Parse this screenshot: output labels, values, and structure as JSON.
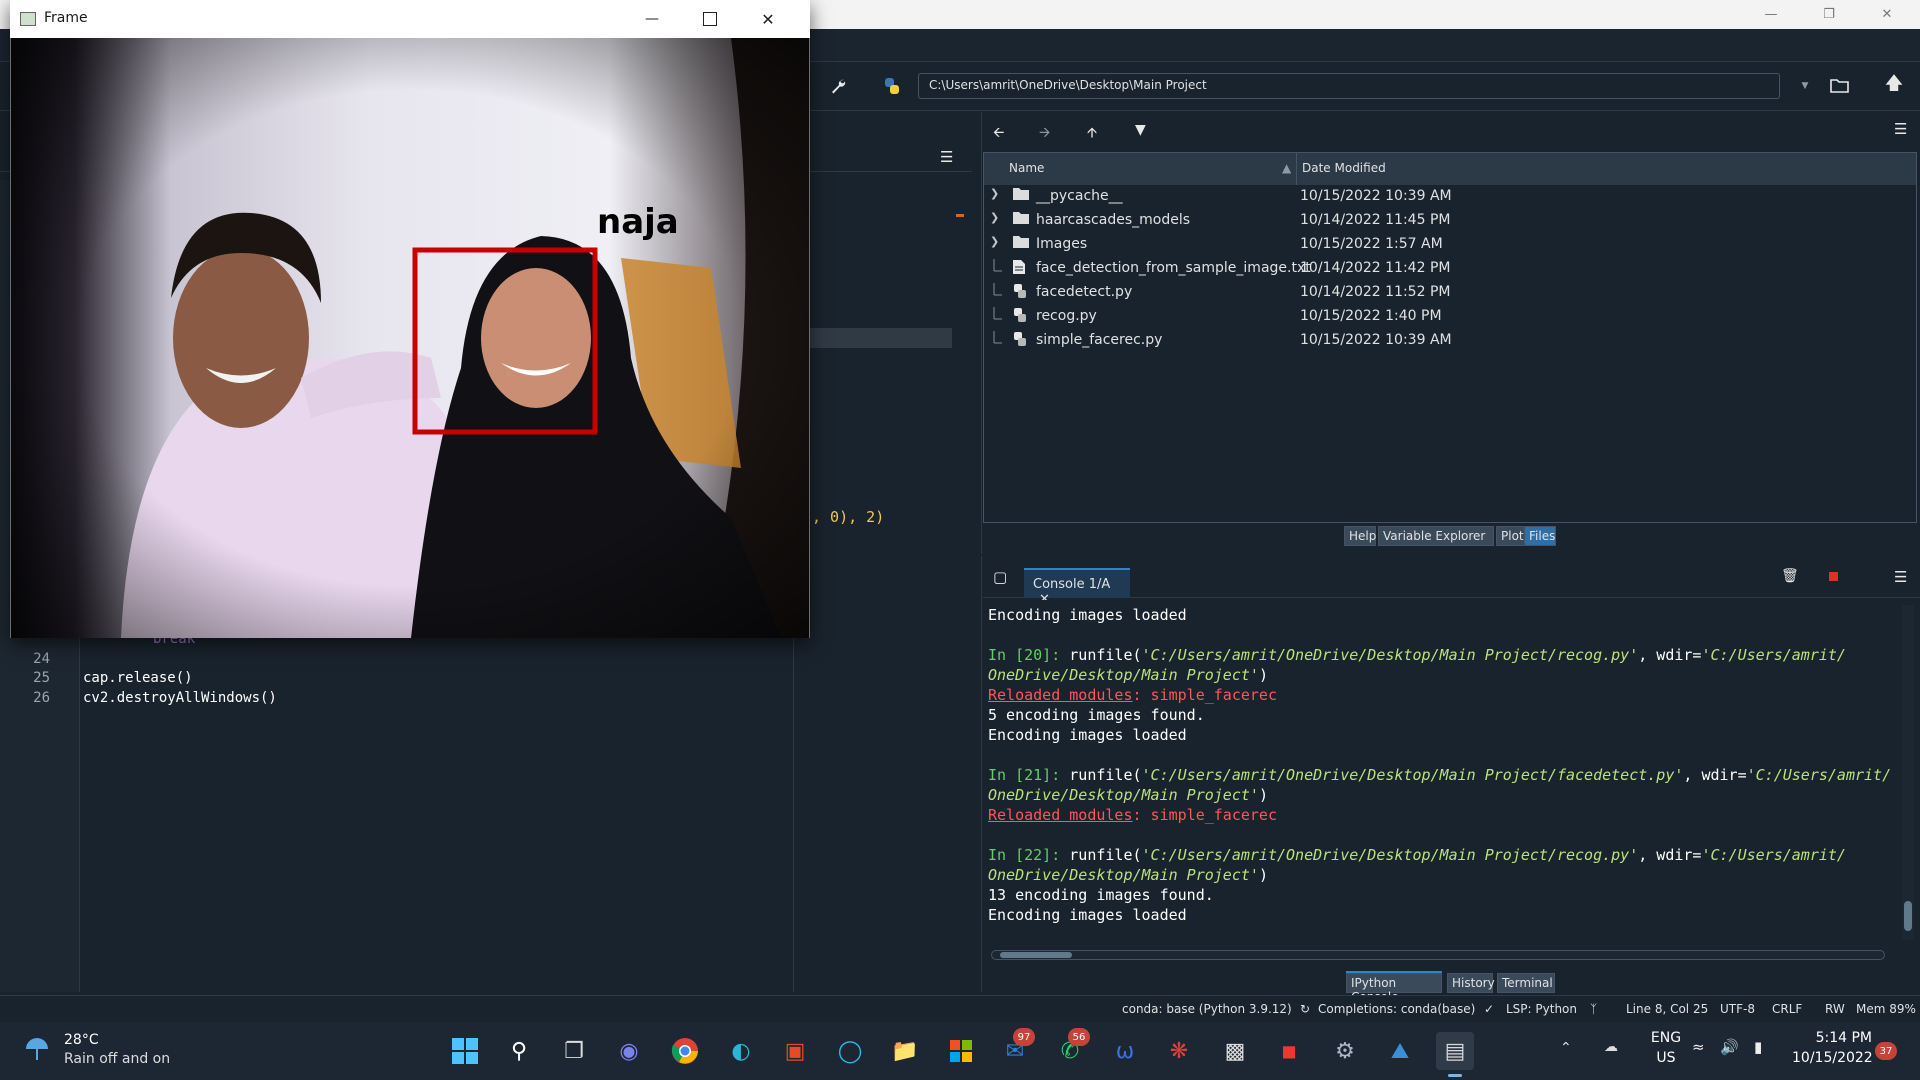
{
  "frame_window": {
    "title": "Frame",
    "detected_name": "naja",
    "controls": [
      "minimize-icon",
      "maximize-icon",
      "close-icon"
    ]
  },
  "toolbar": {
    "path": "C:\\Users\\amrit\\OneDrive\\Desktop\\Main Project"
  },
  "editor": {
    "visible_code_fragment": ", 0), 2)",
    "lines": [
      {
        "n": "25",
        "text": "cap.release()"
      },
      {
        "n": "26",
        "text": "cv2.destroyAllWindows()"
      }
    ],
    "partial": [
      {
        "n": "24",
        "text": ""
      }
    ]
  },
  "files": {
    "columns": {
      "name": "Name",
      "date": "Date Modified"
    },
    "rows": [
      {
        "name": "__pycache__",
        "date": "10/15/2022 10:39 AM",
        "type": "folder"
      },
      {
        "name": "haarcascades_models",
        "date": "10/14/2022 11:45 PM",
        "type": "folder"
      },
      {
        "name": "Images",
        "date": "10/15/2022 1:57 AM",
        "type": "folder"
      },
      {
        "name": "face_detection_from_sample_image.txt",
        "date": "10/14/2022 11:42 PM",
        "type": "text"
      },
      {
        "name": "facedetect.py",
        "date": "10/14/2022 11:52 PM",
        "type": "python"
      },
      {
        "name": "recog.py",
        "date": "10/15/2022 1:40 PM",
        "type": "python"
      },
      {
        "name": "simple_facerec.py",
        "date": "10/15/2022 10:39 AM",
        "type": "python"
      }
    ],
    "tabs": [
      "Help",
      "Variable Explorer",
      "Plots",
      "Files"
    ]
  },
  "console": {
    "tab_label": "Console 1/A",
    "l1": "Encoding images loaded",
    "in20_prompt": "In [20]:",
    "in20_call": " runfile(",
    "in20_arg1": "'C:/Users/amrit/OneDrive/Desktop/Main Project/recog.py'",
    "in20_mid": ", wdir=",
    "in20_arg2a": "'C:/Users/amrit/",
    "in20_arg2b": "OneDrive/Desktop/Main Project'",
    "close_paren": ")",
    "reloaded_label": "Reloaded modules",
    "reloaded_value": ": simple_facerec",
    "found5": "5 encoding images found.",
    "loaded": "Encoding images loaded",
    "in21_prompt": "In [21]:",
    "in21_arg1": "'C:/Users/amrit/OneDrive/Desktop/Main Project/facedetect.py'",
    "in21_arg2a": "'C:/Users/amrit/",
    "in22_prompt": "In [22]:",
    "found13": "13 encoding images found.",
    "tabs": [
      "IPython Console",
      "History",
      "Terminal"
    ]
  },
  "statusbar": {
    "conda": "conda: base (Python 3.9.12)",
    "completions": "Completions: conda(base)",
    "lsp": "LSP: Python",
    "position": "Line 8, Col 25",
    "encoding": "UTF-8",
    "eol": "CRLF",
    "rw": "RW",
    "mem": "Mem 89%"
  },
  "taskbar": {
    "weather_temp": "28°C",
    "weather_desc": "Rain off and on",
    "lang1": "ENG",
    "lang2": "US",
    "time": "5:14 PM",
    "date": "10/15/2022",
    "mail_badge": "97",
    "whatsapp_badge": "56",
    "notif_badge": "37"
  },
  "colors": {
    "bg": "#19232d",
    "accent": "#2a86c7",
    "detect_box": "#c80000"
  }
}
